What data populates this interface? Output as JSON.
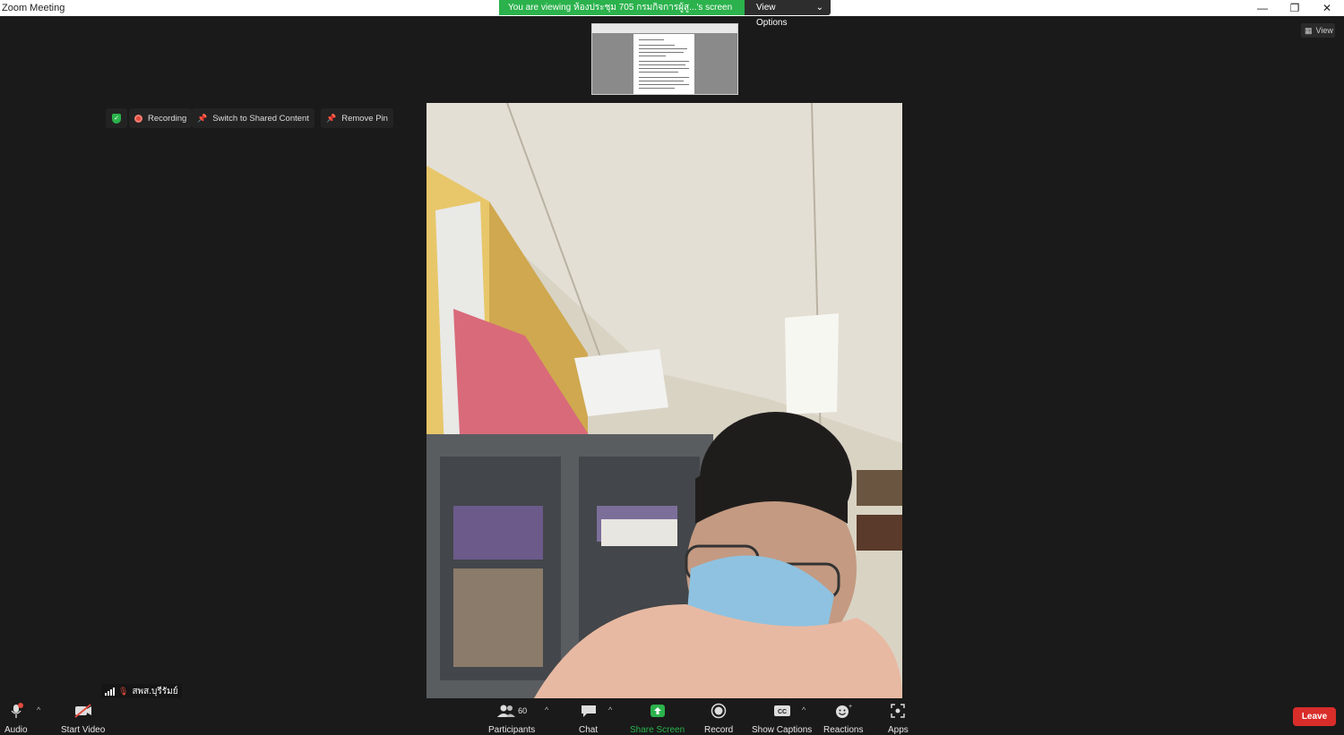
{
  "window": {
    "title": "Zoom Meeting"
  },
  "share_banner": {
    "message": "You are viewing ห้องประชุม 705 กรมกิจการผู้สู...'s screen",
    "view_options": "View Options"
  },
  "view_button": {
    "label": "View"
  },
  "overlay": {
    "recording": "Recording",
    "switch_shared": "Switch to Shared Content",
    "remove_pin": "Remove Pin"
  },
  "participant": {
    "name": "สพส.บุรีรัมย์"
  },
  "toolbar": {
    "audio": "Audio",
    "start_video": "Start Video",
    "participants": "Participants",
    "participants_count": "60",
    "chat": "Chat",
    "share_screen": "Share Screen",
    "record": "Record",
    "captions": "Show Captions",
    "reactions": "Reactions",
    "apps": "Apps",
    "leave": "Leave"
  },
  "colors": {
    "share_green": "#2bb24c",
    "leave_red": "#d92d2a",
    "background": "#1a1a1a"
  }
}
